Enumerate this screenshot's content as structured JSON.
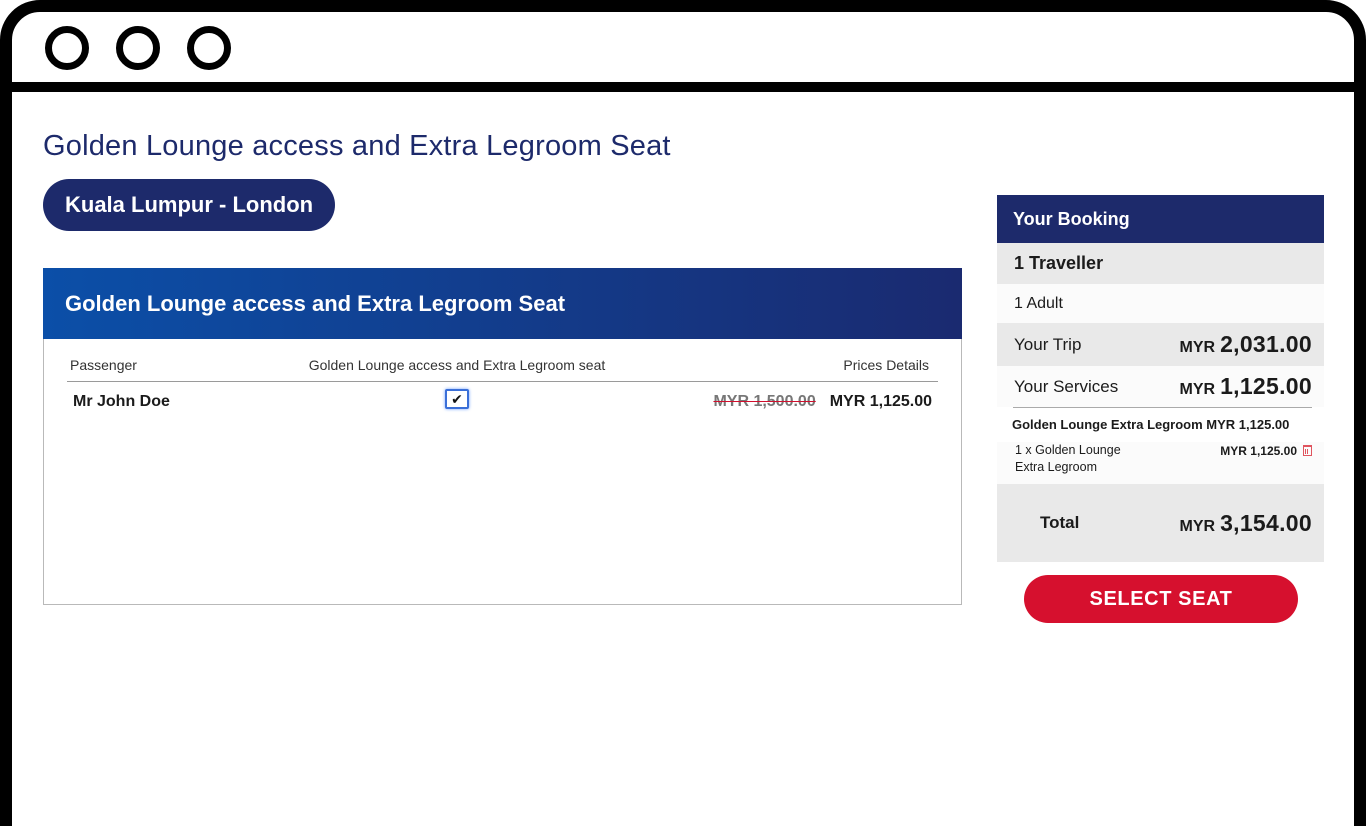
{
  "page": {
    "title": "Golden Lounge access and Extra Legroom Seat",
    "route": "Kuala Lumpur - London"
  },
  "card": {
    "header": "Golden Lounge access and Extra Legroom Seat",
    "columns": {
      "passenger": "Passenger",
      "service": "Golden Lounge access and Extra Legroom seat",
      "price": "Prices Details"
    },
    "rows": [
      {
        "passenger": "Mr John Doe",
        "checked": true,
        "old_price": "MYR 1,500.00",
        "price": "MYR 1,125.00"
      }
    ]
  },
  "booking": {
    "header": "Your Booking",
    "travellers": "1 Traveller",
    "adults": "1 Adult",
    "trip_label": "Your Trip",
    "trip_currency": "MYR",
    "trip_amount": "2,031.00",
    "services_label": "Your Services",
    "services_currency": "MYR",
    "services_amount": "1,125.00",
    "service_title": "Golden Lounge Extra Legroom MYR 1,125.00",
    "item_label": "1 x Golden Lounge Extra Legroom",
    "item_price": "MYR 1,125.00",
    "total_label": "Total",
    "total_currency": "MYR",
    "total_amount": "3,154.00"
  },
  "actions": {
    "select_seat": "SELECT SEAT"
  },
  "colors": {
    "navy": "#1d2a6b",
    "header_gradient_start": "#0b4fa8",
    "button_red": "#d6102e",
    "panel_gray": "#e9e9e9"
  }
}
